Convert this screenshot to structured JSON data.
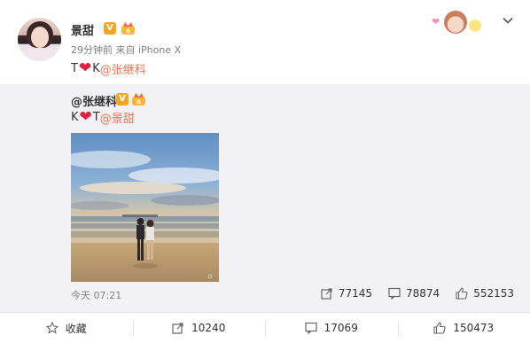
{
  "post": {
    "author": "景甜",
    "verified_badge": "V",
    "meta": "29分钟前 来自 iPhone X",
    "text_before": "T",
    "text_mid": "K",
    "mention": "@张继科"
  },
  "repost": {
    "author": "@张继科",
    "verified_badge": "V",
    "text_before": "K",
    "text_mid": "T",
    "mention": "@景甜",
    "time": "今天 07:21",
    "stats": {
      "forwards": "77145",
      "comments": "78874",
      "likes": "552153"
    }
  },
  "actions": {
    "collect": "收藏",
    "forward": "10240",
    "comment": "17069",
    "like": "150473"
  },
  "colors": {
    "mention": "#eb7350",
    "heart": "#e0203a",
    "badge": "#f5a623",
    "repost_bg": "#f2f2f5"
  }
}
